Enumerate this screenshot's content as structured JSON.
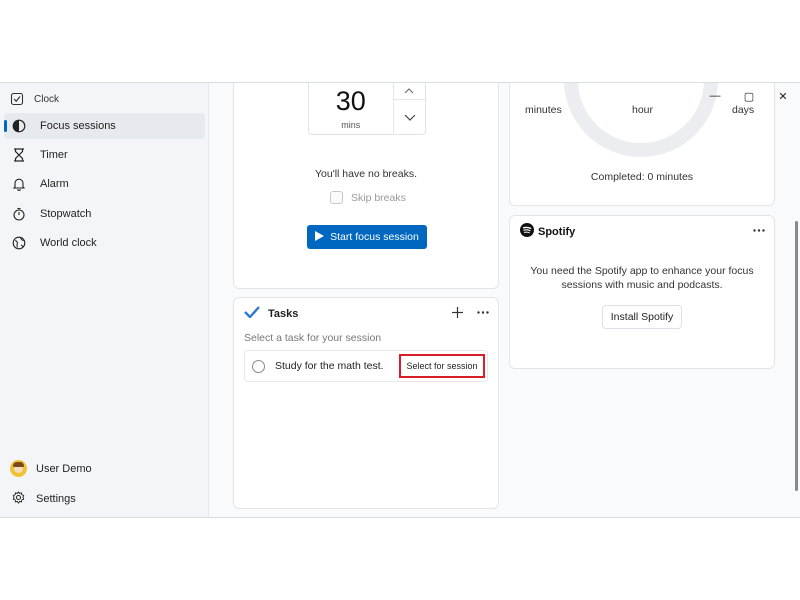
{
  "app": {
    "title": "Clock",
    "window_controls": {
      "minimize": "—",
      "maximize": "▢",
      "close": "✕"
    }
  },
  "sidebar": {
    "items": [
      {
        "label": "Focus sessions",
        "icon": "focus-icon",
        "active": true
      },
      {
        "label": "Timer",
        "icon": "hourglass-icon",
        "active": false
      },
      {
        "label": "Alarm",
        "icon": "bell-icon",
        "active": false
      },
      {
        "label": "Stopwatch",
        "icon": "stopwatch-icon",
        "active": false
      },
      {
        "label": "World clock",
        "icon": "globe-icon",
        "active": false
      }
    ],
    "user": {
      "name": "User Demo"
    },
    "settings_label": "Settings"
  },
  "focus": {
    "minutes_value": "30",
    "minutes_unit": "mins",
    "breaks_text": "You'll have no breaks.",
    "skip_breaks_label": "Skip breaks",
    "start_button_label": "Start focus session"
  },
  "tasks": {
    "title": "Tasks",
    "subtitle": "Select a task for your session",
    "items": [
      {
        "text": "Study for the math test.",
        "action_label": "Select for session"
      }
    ]
  },
  "progress": {
    "labels": {
      "left": "minutes",
      "center": "hour",
      "right": "days"
    },
    "completed_text": "Completed: 0 minutes"
  },
  "spotify": {
    "brand": "Spotify",
    "message": "You need the Spotify app to enhance your focus sessions with music and podcasts.",
    "install_button_label": "Install Spotify"
  },
  "colors": {
    "accent": "#0067c0",
    "highlight_border": "#d81e2b",
    "spotify": "#111111"
  }
}
